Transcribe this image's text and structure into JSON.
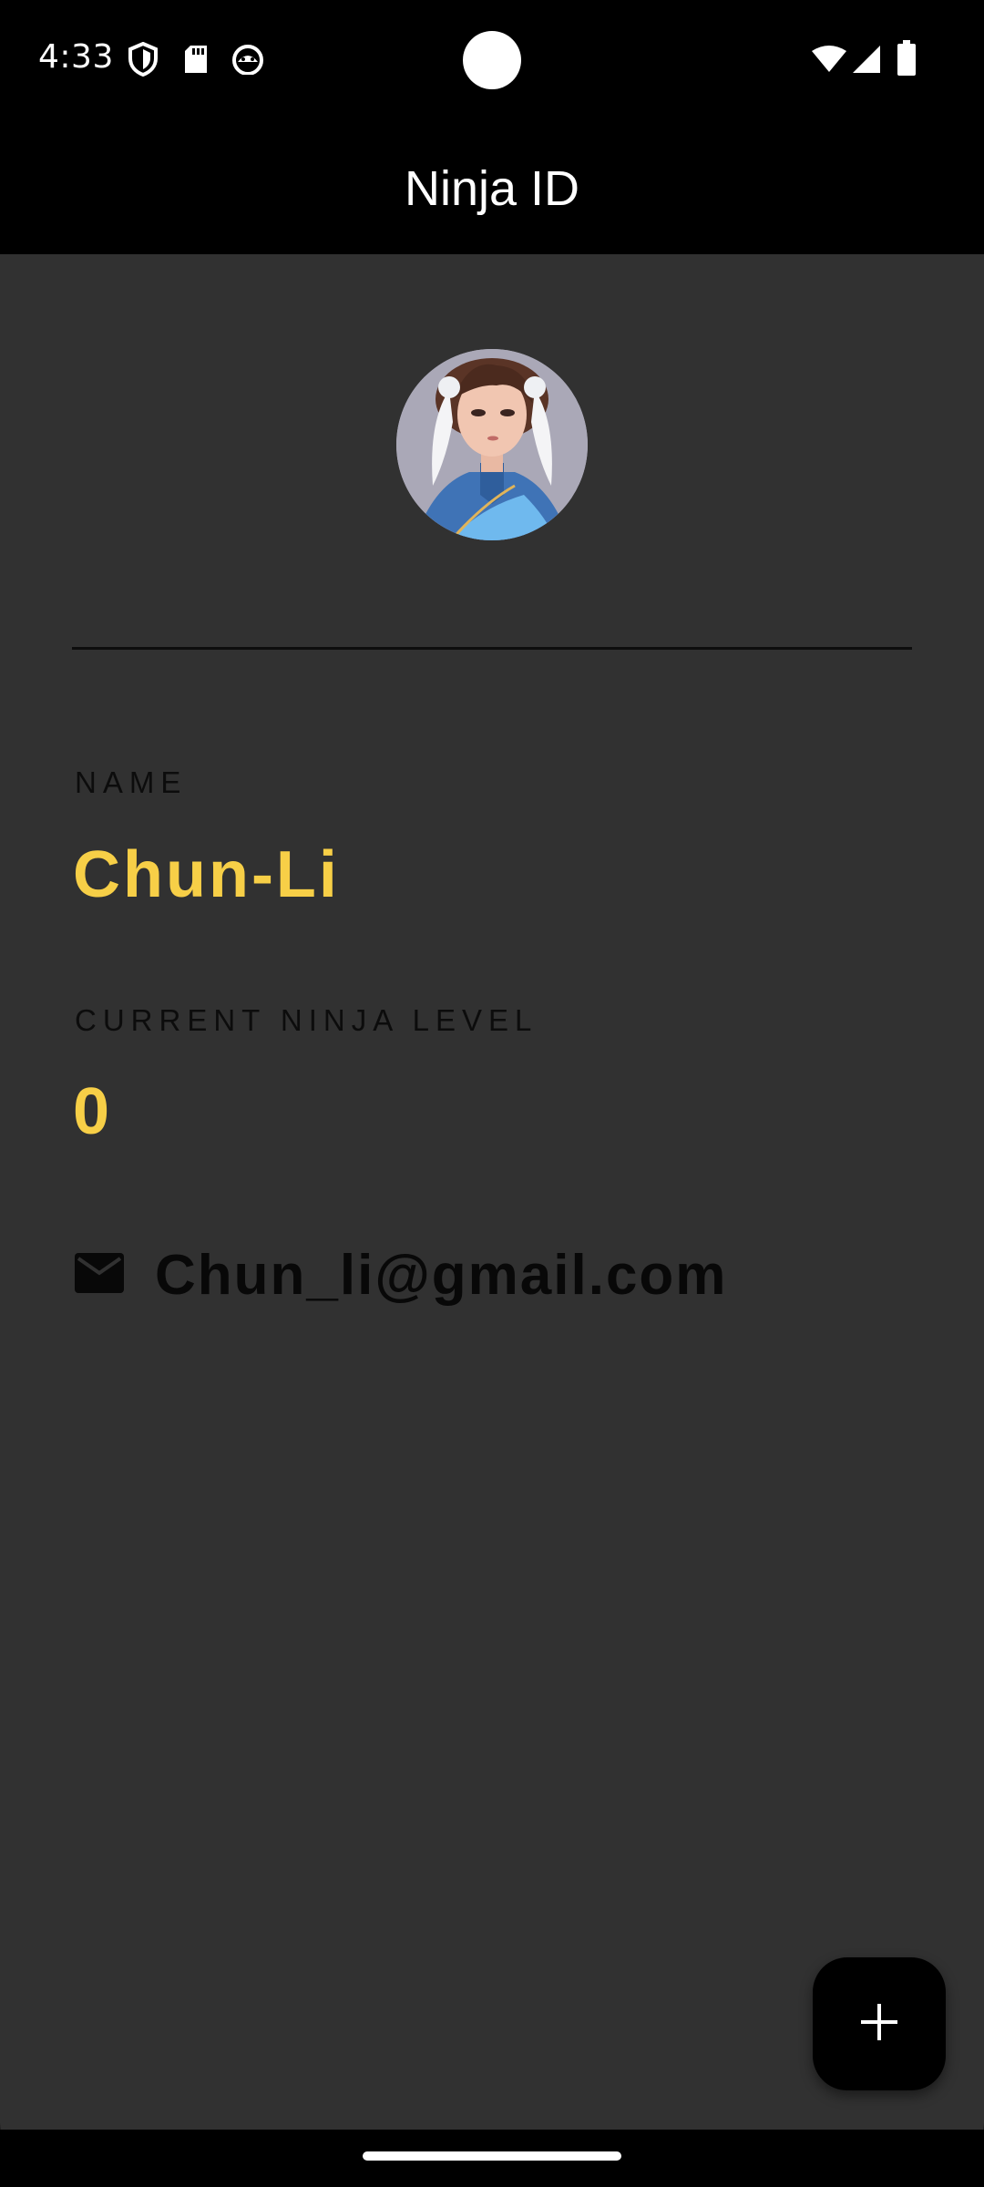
{
  "status_bar": {
    "time": "4:33",
    "left_icons": [
      "shield-icon",
      "sd-card-icon",
      "android-cat-icon"
    ],
    "right_icons": [
      "wifi-icon",
      "signal-icon",
      "battery-icon"
    ]
  },
  "app_bar": {
    "title": "Ninja ID"
  },
  "profile": {
    "avatar": "anime-character-portrait",
    "name_label": "NAME",
    "name_value": "Chun-Li",
    "level_label": "CURRENT NINJA LEVEL",
    "level_value": "0",
    "email_icon": "mail-icon",
    "email": "Chun_li@gmail.com"
  },
  "fab": {
    "icon": "plus-icon"
  },
  "colors": {
    "background": "#313131",
    "bars": "#000000",
    "accent": "#f7cf47",
    "label": "#0c0c0c"
  }
}
